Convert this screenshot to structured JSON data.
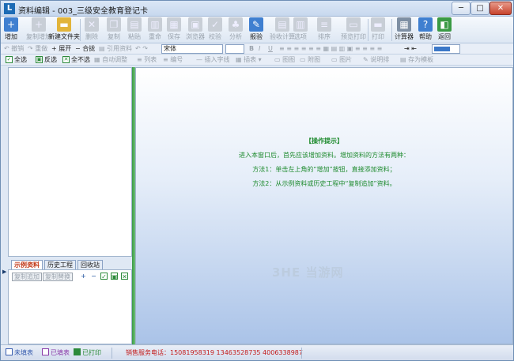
{
  "window": {
    "title": "资料编辑 - 003_三级安全教育登记卡",
    "app_icon_glyph": "L",
    "min_glyph": "─",
    "max_glyph": "□",
    "close_glyph": "✕"
  },
  "toolbar": {
    "buttons": [
      {
        "label": "增加",
        "icon": "add-doc-icon",
        "glyph": "+",
        "color": "#3f7fd0",
        "enabled": true
      },
      {
        "label": "复制增加",
        "icon": "copy-add-icon",
        "glyph": "+",
        "color": "#9aa8b8",
        "enabled": false
      },
      {
        "label": "新建文件夹",
        "icon": "new-folder-icon",
        "glyph": "▬",
        "color": "#e2b43a",
        "enabled": true
      },
      {
        "label": "删除",
        "icon": "delete-icon",
        "glyph": "✕",
        "color": "#c8ced6",
        "enabled": false
      },
      {
        "label": "复制",
        "icon": "copy-icon",
        "glyph": "❐",
        "color": "#c8ced6",
        "enabled": false
      },
      {
        "label": "粘贴",
        "icon": "paste-icon",
        "glyph": "▤",
        "color": "#c8ced6",
        "enabled": false
      },
      {
        "label": "重命",
        "icon": "rename-icon",
        "glyph": "▥",
        "color": "#c8ced6",
        "enabled": false
      },
      {
        "label": "保存",
        "icon": "save-icon",
        "glyph": "▦",
        "color": "#c8ced6",
        "enabled": false
      },
      {
        "label": "浏览器",
        "icon": "browser-icon",
        "glyph": "▣",
        "color": "#c8ced6",
        "enabled": false
      },
      {
        "label": "校验",
        "icon": "check-icon",
        "glyph": "✓",
        "color": "#c8ced6",
        "enabled": false
      },
      {
        "label": "分析",
        "icon": "analyze-icon",
        "glyph": "♣",
        "color": "#c8ced6",
        "enabled": false
      },
      {
        "label": "报验",
        "icon": "report-icon",
        "glyph": "✎",
        "color": "#3f7fd0",
        "enabled": true
      },
      {
        "label": "验收计算",
        "icon": "calc-accept-icon",
        "glyph": "▤",
        "color": "#c8ced6",
        "enabled": false
      },
      {
        "label": "选项",
        "icon": "options-icon",
        "glyph": "▥",
        "color": "#c8ced6",
        "enabled": false
      },
      {
        "label": "排序",
        "icon": "sort-icon",
        "glyph": "≡",
        "color": "#c8ced6",
        "enabled": false
      },
      {
        "label": "预览打印",
        "icon": "print-preview-icon",
        "glyph": "▭",
        "color": "#c8ced6",
        "enabled": false
      },
      {
        "label": "打印",
        "icon": "print-icon",
        "glyph": "▬",
        "color": "#c8ced6",
        "enabled": false
      },
      {
        "label": "计算器",
        "icon": "calculator-icon",
        "glyph": "▦",
        "color": "#7e8fa3",
        "enabled": true
      },
      {
        "label": "帮助",
        "icon": "help-icon",
        "glyph": "?",
        "color": "#3f7fd0",
        "enabled": true
      },
      {
        "label": "返回",
        "icon": "return-icon",
        "glyph": "◧",
        "color": "#3a9a44",
        "enabled": true
      }
    ]
  },
  "format_bar": {
    "undo": "撤销",
    "redo": "重做",
    "expand": "展开",
    "collapse": "合拢",
    "reference": "引用资料",
    "font": "宋体",
    "size": "",
    "bold": "B",
    "italic": "I",
    "underline": "U",
    "color_value": "#3b78c8"
  },
  "list_bar": {
    "select_all": "全选",
    "invert": "反选",
    "select_none": "全不选",
    "auto_adjust": "自动调整",
    "table": "列表",
    "number": "编号",
    "insert_line": "插入字线",
    "insert": "插表",
    "picture": "图图",
    "attach": "附图",
    "image": "图片",
    "sign": "说明排",
    "stamp": "存为模板"
  },
  "tabs": [
    {
      "label": "示例资料",
      "active": true
    },
    {
      "label": "历史工程",
      "active": false
    },
    {
      "label": "回收站",
      "active": false
    }
  ],
  "tab_panel": {
    "copy_add": "复制追加",
    "copy_replace": "复制替换",
    "icons": [
      "+",
      "−",
      "✓",
      "▣",
      "✕"
    ]
  },
  "hint": {
    "title": "【操作提示】",
    "line1": "进入本窗口后，首先应该增加资料。增加资料的方法有两种：",
    "line2": "方法1：单击左上角的“增加”按钮，直接添加资料；",
    "line3": "方法2：从示例资料或历史工程中“复制追加”资料。"
  },
  "watermark": "3HE 当游网",
  "status": {
    "unfilled": "未填表",
    "filled": "已填表",
    "printed": "已打印",
    "hotline": "销售服务电话：15081958319 13463528735 4006338987",
    "unfilled_color": "#3a5fb0",
    "filled_color": "#8a3aa8",
    "printed_color": "#2c8a3a",
    "hotline_color": "#c21a1a"
  }
}
